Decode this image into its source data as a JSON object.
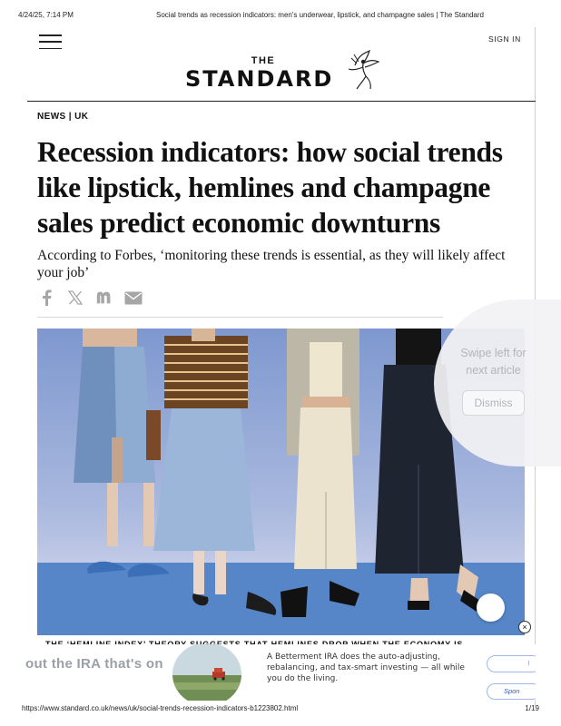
{
  "print_header": {
    "datetime": "4/24/25, 7:14 PM",
    "page_title": "Social trends as recession indicators: men's underwear, lipstick, and champagne sales | The Standard"
  },
  "nav": {
    "menu_icon": "hamburger-menu-icon",
    "signin_label": "SIGN IN"
  },
  "masthead": {
    "the": "THE",
    "standard": "STANDARD",
    "logo_icon": "winged-figure-logo"
  },
  "article": {
    "section": "NEWS | UK",
    "headline": "Recession indicators: how social trends like lipstick, hemlines and champagne sales predict economic downturns",
    "standfirst": "According to Forbes, ‘monitoring these trends is essential, as they will likely affect your job’",
    "share_icons": [
      "facebook-icon",
      "x-icon",
      "flipboard-icon",
      "email-icon"
    ],
    "caption": "THE ‘HEMLINE INDEX’ THEORY SUGGESTS THAT HEMLINES DROP WHEN THE ECONOMY IS"
  },
  "swipe_overlay": {
    "text": "Swipe left for next article",
    "dismiss_label": "Dismiss"
  },
  "ad": {
    "marquee": "out the IRA that's on",
    "body": "A Betterment IRA does the auto-adjusting, rebalancing, and tax-smart investing — all while you do the living.",
    "button_top": "l",
    "button_bottom": "Spon"
  },
  "print_footer": {
    "url": "https://www.standard.co.uk/news/uk/social-trends-recession-indicators-b1223802.html",
    "page": "1/19"
  },
  "colors": {
    "hero_sky": "#8fa6d6",
    "hero_floor": "#4f7ec4",
    "ad_button_border": "#9fb8e8"
  }
}
